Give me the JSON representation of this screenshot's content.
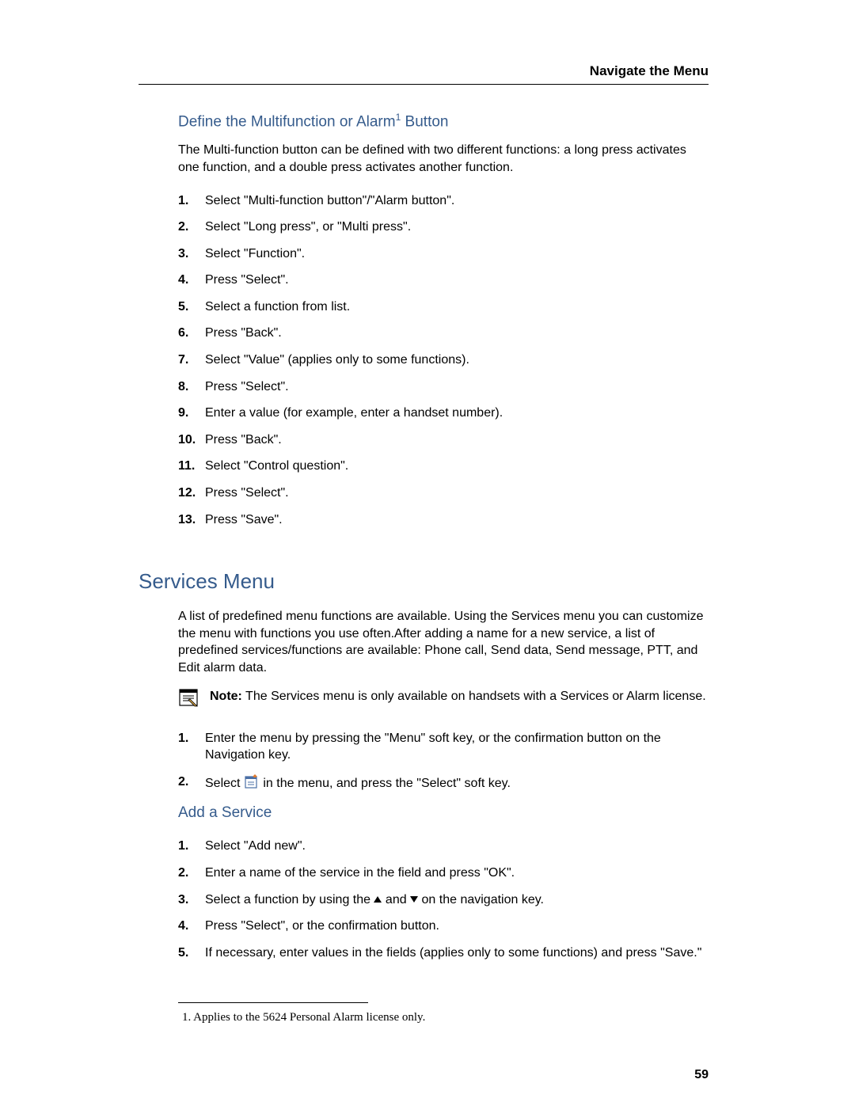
{
  "header": "Navigate the Menu",
  "section1": {
    "title_pre": "Define the Multifunction or Alarm",
    "title_sup": "1",
    "title_post": " Button",
    "intro": "The Multi-function button can be defined with two different functions: a long press activates one function, and a double press activates another function.",
    "steps": [
      "Select \"Multi-function button\"/\"Alarm button\".",
      "Select \"Long press\", or \"Multi press\".",
      "Select \"Function\".",
      "Press \"Select\".",
      "Select a function from list.",
      "Press \"Back\".",
      "Select \"Value\" (applies only to some functions).",
      "Press \"Select\".",
      "Enter a value  (for example, enter a handset number).",
      "Press \"Back\".",
      "Select \"Control question\".",
      "Press \"Select\".",
      "Press \"Save\"."
    ]
  },
  "section2": {
    "title": "Services Menu",
    "intro": "A list of predefined menu functions are available. Using the Services menu you can customize the menu with functions you use often.After adding a name for a new service, a list of predefined services/functions are available: Phone call, Send data, Send message, PTT, and Edit alarm data.",
    "note_label": "Note:",
    "note_body": " The Services menu is only available on handsets with a Services or Alarm license.",
    "steps": [
      "Enter the menu by pressing the \"Menu\" soft key, or the confirmation button on the Navigation key.",
      "__ICON_STEP__"
    ],
    "step2_pre": "Select ",
    "step2_post": " in the menu, and press the \"Select\" soft key."
  },
  "section3": {
    "title": "Add a Service",
    "steps": [
      "Select \"Add new\".",
      "Enter a name of the service in the field and press \"OK\".",
      "__ARROW_STEP__",
      "Press \"Select\", or the confirmation button.",
      "If necessary, enter values in the fields (applies only to some functions) and press \"Save.\""
    ],
    "step3_pre": "Select a function by using the ",
    "step3_mid": " and ",
    "step3_post": " on the navigation key."
  },
  "footnote": "1. Applies to the 5624 Personal Alarm license only.",
  "page_number": "59"
}
